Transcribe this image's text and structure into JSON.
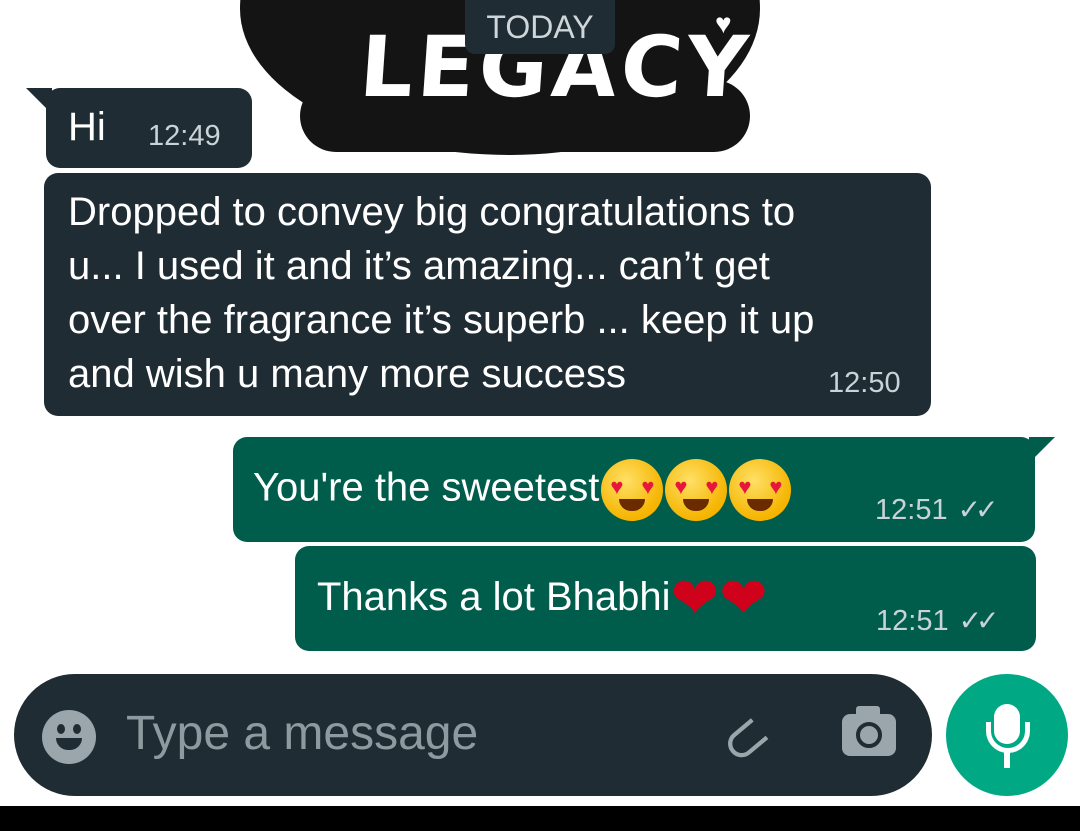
{
  "wallpaper": {
    "text": "LEGACY"
  },
  "date_chip": "TODAY",
  "messages": [
    {
      "direction": "in",
      "text": "Hi",
      "time": "12:49"
    },
    {
      "direction": "in",
      "text": "Dropped to convey big congratulations to u... I used it and it’s amazing... can’t get over the fragrance it’s superb ... keep it up and wish u many more success",
      "time": "12:50"
    },
    {
      "direction": "out",
      "text": "You're the sweetest",
      "emojis": [
        "heart-eyes-emoji",
        "heart-eyes-emoji",
        "heart-eyes-emoji"
      ],
      "time": "12:51",
      "status": "read"
    },
    {
      "direction": "out",
      "text": "Thanks a lot Bhabhi",
      "emojis": [
        "red-heart-emoji",
        "red-heart-emoji"
      ],
      "time": "12:51",
      "status": "read"
    }
  ],
  "composer": {
    "placeholder": "Type a message",
    "icons": [
      "emoji-icon",
      "attach-icon",
      "camera-icon",
      "mic-icon"
    ]
  },
  "colors": {
    "incoming_bubble": "#1f2c33",
    "outgoing_bubble": "#005c4b",
    "mic_button": "#00a884"
  }
}
